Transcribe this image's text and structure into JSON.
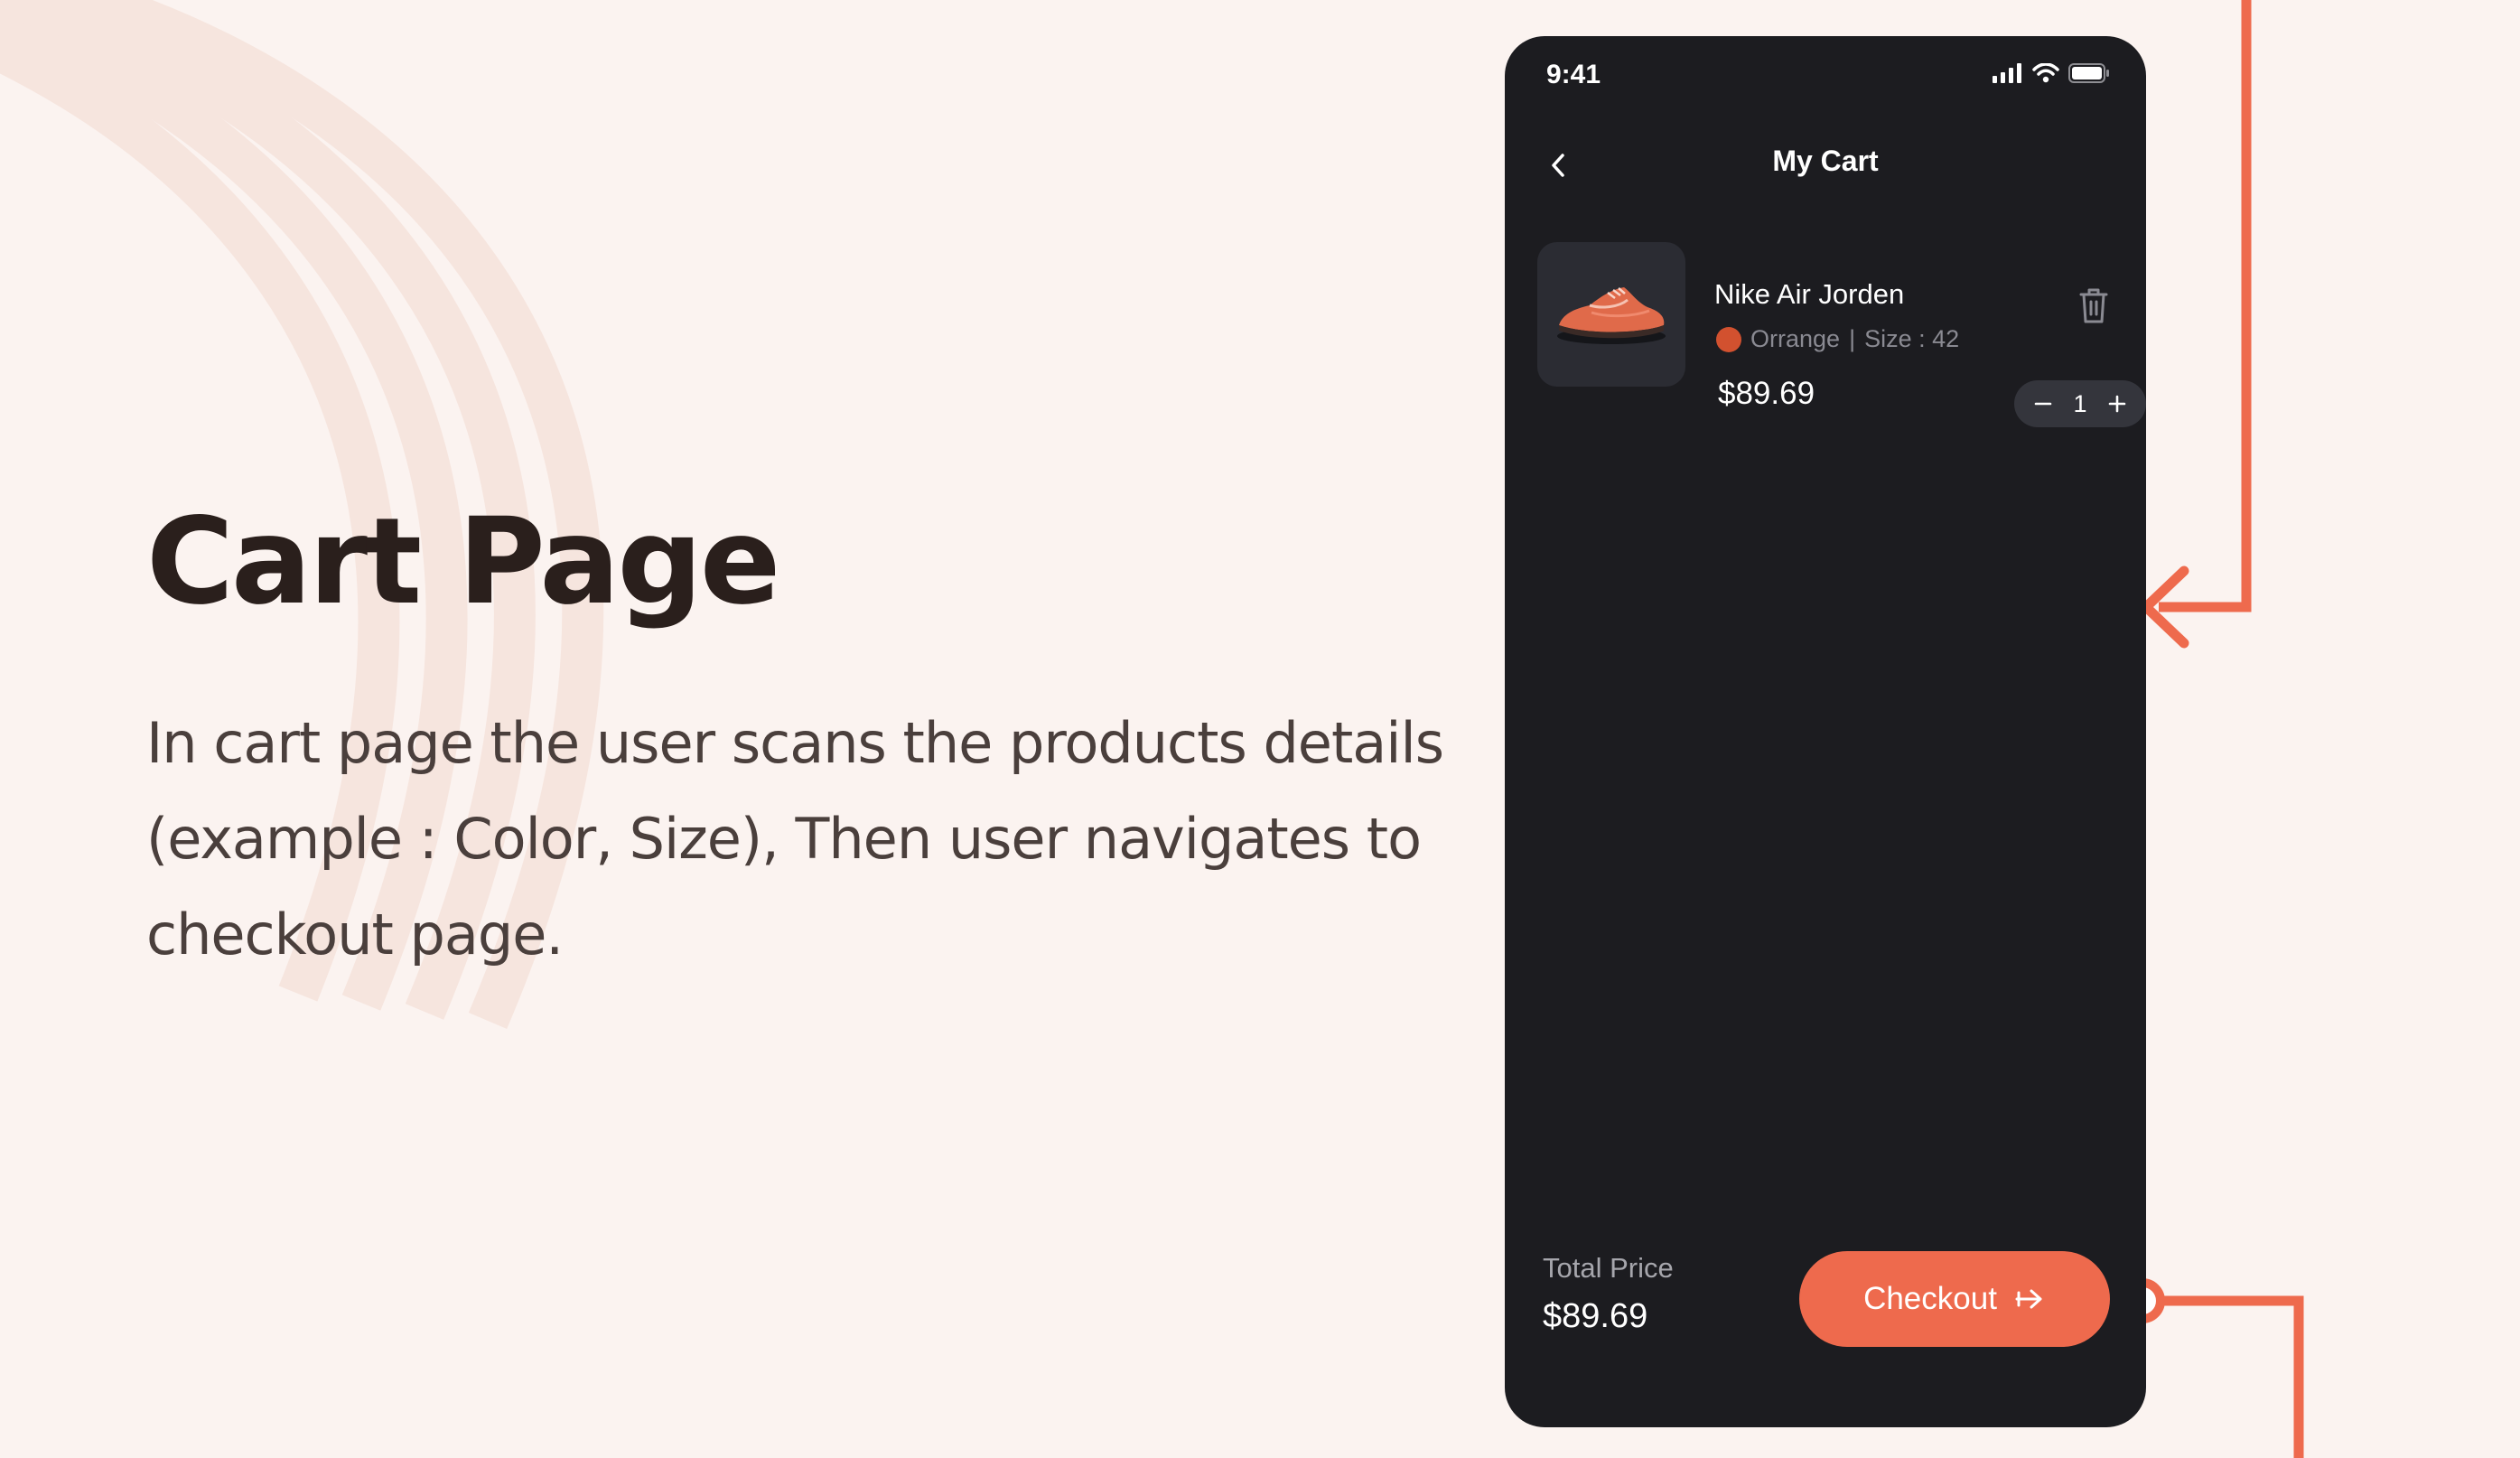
{
  "slide": {
    "title": "Cart Page",
    "description": "In cart page the user scans the products details (example : Color, Size), Then user navigates to checkout page."
  },
  "phone": {
    "status_time": "9:41",
    "header_title": "My Cart",
    "item": {
      "name": "Nike Air Jorden",
      "color_name": "Orrange",
      "separator": "|",
      "size": "Size : 42",
      "price": "$89.69",
      "quantity": "1",
      "color_swatch": "#d2512f"
    },
    "total_label": "Total Price",
    "total_value": "$89.69",
    "checkout_label": "Checkout"
  },
  "colors": {
    "background": "#fbf3f0",
    "phone": "#1c1c20",
    "accent": "#ee6a4d",
    "heading": "#2a1f1c"
  },
  "icons": [
    "back-chevron-icon",
    "trash-icon",
    "minus-icon",
    "plus-icon",
    "arrow-right-icon",
    "signal-icon",
    "wifi-icon",
    "battery-icon"
  ]
}
